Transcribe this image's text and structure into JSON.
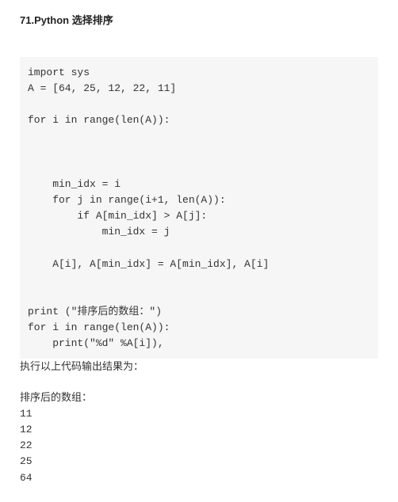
{
  "title": "71.Python 选择排序",
  "code": "import sys\nA = [64, 25, 12, 22, 11]\n\nfor i in range(len(A)):\n\n\n\n    min_idx = i\n    for j in range(i+1, len(A)):\n        if A[min_idx] > A[j]:\n            min_idx = j\n\n    A[i], A[min_idx] = A[min_idx], A[i]\n\n\nprint (\"排序后的数组：\")\nfor i in range(len(A)):\n    print(\"%d\" %A[i]),",
  "exec_note": "执行以上代码输出结果为：",
  "output": "\n排序后的数组：\n11\n12\n22\n25\n64"
}
